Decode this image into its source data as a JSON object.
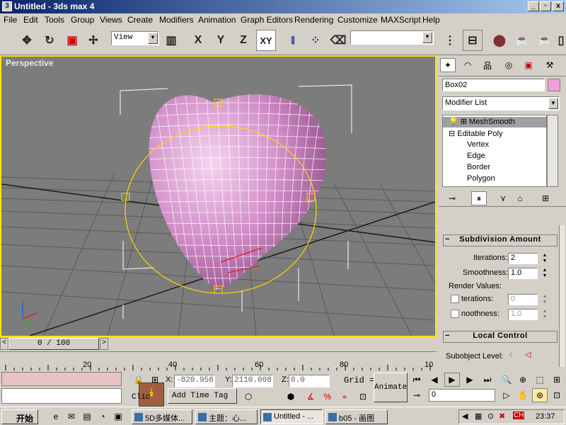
{
  "window": {
    "title": "Untitled - 3ds max 4",
    "min": "_",
    "max": "▫",
    "close": "x"
  },
  "menu": [
    "File",
    "Edit",
    "Tools",
    "Group",
    "Views",
    "Create",
    "Modifiers",
    "Animation",
    "Graph Editors",
    "Rendering",
    "Customize",
    "MAXScript",
    "Help"
  ],
  "toolbar": {
    "ref_coord": "View",
    "axis_x": "X",
    "axis_y": "Y",
    "axis_z": "Z",
    "axis_xy": "XY",
    "named_selection": ""
  },
  "viewport": {
    "label": "Perspective"
  },
  "command_panel": {
    "object_name": "Box02",
    "object_color": "#f0a0d8",
    "modifier_list": "Modifier List",
    "stack": [
      "MeshSmooth",
      "Editable Poly",
      "Vertex",
      "Edge",
      "Border",
      "Polygon"
    ],
    "subdivision_title": "Subdivision Amount",
    "iterations_label": "Iterations:",
    "iterations_value": "2",
    "smoothness_label": "Smoothness:",
    "smoothness_value": "1.0",
    "render_values_label": "Render Values:",
    "render_iterations_label": "terations:",
    "render_iterations_value": "0",
    "render_smoothness_label": "noothness:",
    "render_smoothness_value": "1.0",
    "local_control_title": "Local Control",
    "subobject_label": "Subobject Level:"
  },
  "time": {
    "slider": "0 / 100",
    "ticks": [
      "20",
      "40",
      "60",
      "80",
      "10"
    ]
  },
  "status": {
    "x_label": "X:",
    "x_value": "-820.956",
    "y_label": "Y:",
    "y_value": "2110.008",
    "z_label": "Z:",
    "z_value": "0.0",
    "grid_label": "Grid =",
    "animate_label": "Animate",
    "add_time_tag": "Add Time Tag",
    "click_prompt": "Clic",
    "frame_field": "0"
  },
  "taskbar": {
    "start": "开始",
    "tasks": [
      "5D多媒体...",
      "主题：心...",
      "Untitled - ...",
      "b05 - 画图"
    ],
    "tray_lang": "CH",
    "clock": "23:37"
  }
}
